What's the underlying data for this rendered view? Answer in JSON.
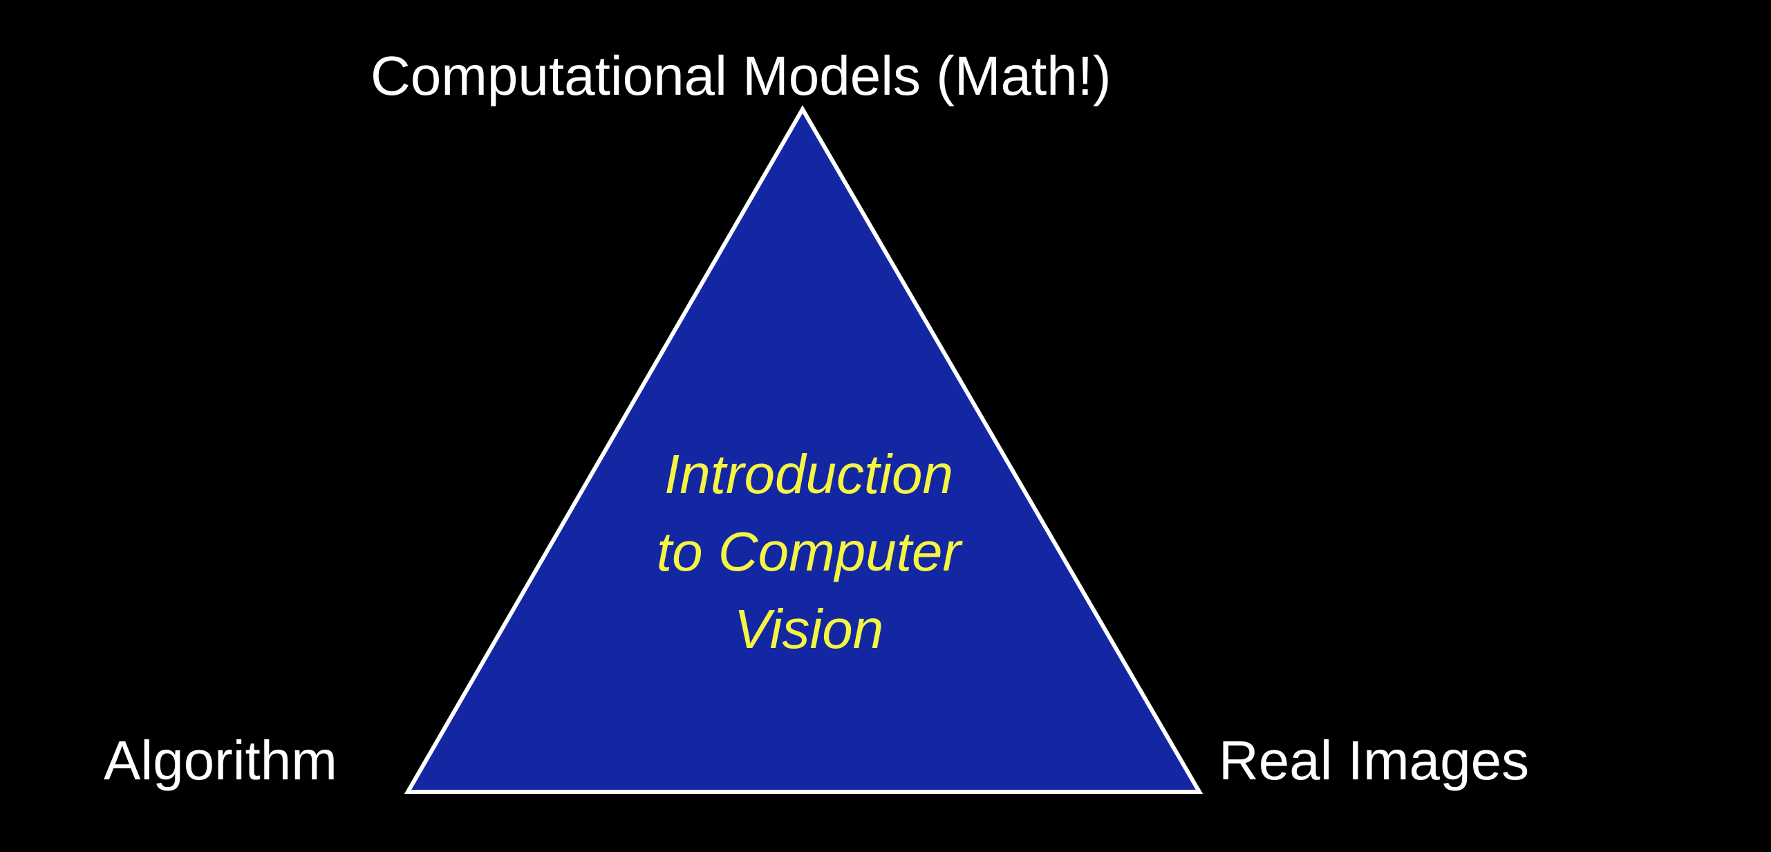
{
  "slide": {
    "top_vertex_label": "Computational Models (Math!)",
    "left_vertex_label": "Algorithm",
    "right_vertex_label": "Real Images",
    "center_title_lines": [
      "Introduction",
      "to Computer",
      "Vision"
    ]
  },
  "colors": {
    "background": "#000000",
    "triangle_fill": "#1427a3",
    "triangle_stroke": "#ffffff",
    "label_text": "#ffffff",
    "center_text": "#f5f542"
  }
}
